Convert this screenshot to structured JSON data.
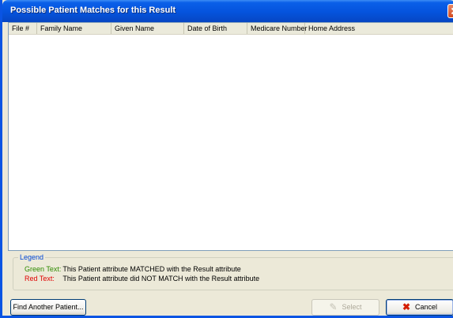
{
  "window": {
    "title": "Possible Patient Matches for this Result"
  },
  "list": {
    "columns": [
      "File #",
      "Family Name",
      "Given Name",
      "Date of Birth",
      "Medicare Number",
      "Home Address"
    ],
    "rows": []
  },
  "legend": {
    "title": "Legend",
    "items": [
      {
        "key": "Green Text:",
        "desc": "This Patient attribute MATCHED with the Result attribute",
        "color": "#2e8b00"
      },
      {
        "key": "Red Text:",
        "desc": "This Patient attribute did NOT MATCH with the Result attribute",
        "color": "#e00000"
      }
    ]
  },
  "buttons": {
    "find_another": "Find Another Patient...",
    "select": "Select",
    "cancel": "Cancel",
    "select_icon": "pencil-check-icon",
    "cancel_icon": "red-x-icon"
  }
}
